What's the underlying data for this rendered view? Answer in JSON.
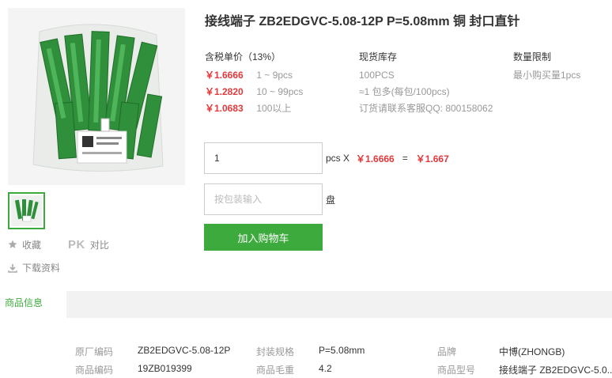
{
  "product": {
    "title": "接线端子 ZB2EDGVC-5.08-12P P=5.08mm 铜 封口直针"
  },
  "pricing": {
    "header": "含税单价（13%）",
    "tiers": [
      {
        "price": "￥1.6666",
        "range": "1 ~ 9pcs"
      },
      {
        "price": "￥1.2820",
        "range": "10 ~ 99pcs"
      },
      {
        "price": "￥1.0683",
        "range": "100以上"
      }
    ]
  },
  "stock": {
    "header": "现货库存",
    "lines": [
      "100PCS",
      "≈1 包多(每包/100pcs)",
      "订货请联系客服QQ: 800158062"
    ]
  },
  "limit": {
    "header": "数量限制",
    "line": "最小购买量1pcs"
  },
  "order": {
    "quantity_value": "1",
    "unit": "pcs X",
    "unit_price": "￥1.6666",
    "equals": "=",
    "total": "￥1.667",
    "pack_placeholder": "按包装输入",
    "pack_unit": "盘",
    "cart_label": "加入购物车"
  },
  "actions": {
    "favorite": "收藏",
    "pk": "PK",
    "compare": "对比",
    "download": "下载资料"
  },
  "tabs": {
    "product_info": "商品信息"
  },
  "specs": {
    "rows": [
      [
        {
          "key": "原厂编码",
          "value": "ZB2EDGVC-5.08-12P"
        },
        {
          "key": "封装规格",
          "value": "P=5.08mm"
        },
        {
          "key": "品牌",
          "value": "中博(ZHONGB)"
        }
      ],
      [
        {
          "key": "商品编码",
          "value": "19ZB019399"
        },
        {
          "key": "商品毛重",
          "value": "4.2"
        },
        {
          "key": "商品型号",
          "value": "接线端子 ZB2EDGVC-5.0..."
        }
      ]
    ]
  },
  "colors": {
    "accent_green": "#3daa3d",
    "price_red": "#e4393c"
  },
  "icons": {
    "favorite": "star-icon",
    "download": "download-icon"
  }
}
